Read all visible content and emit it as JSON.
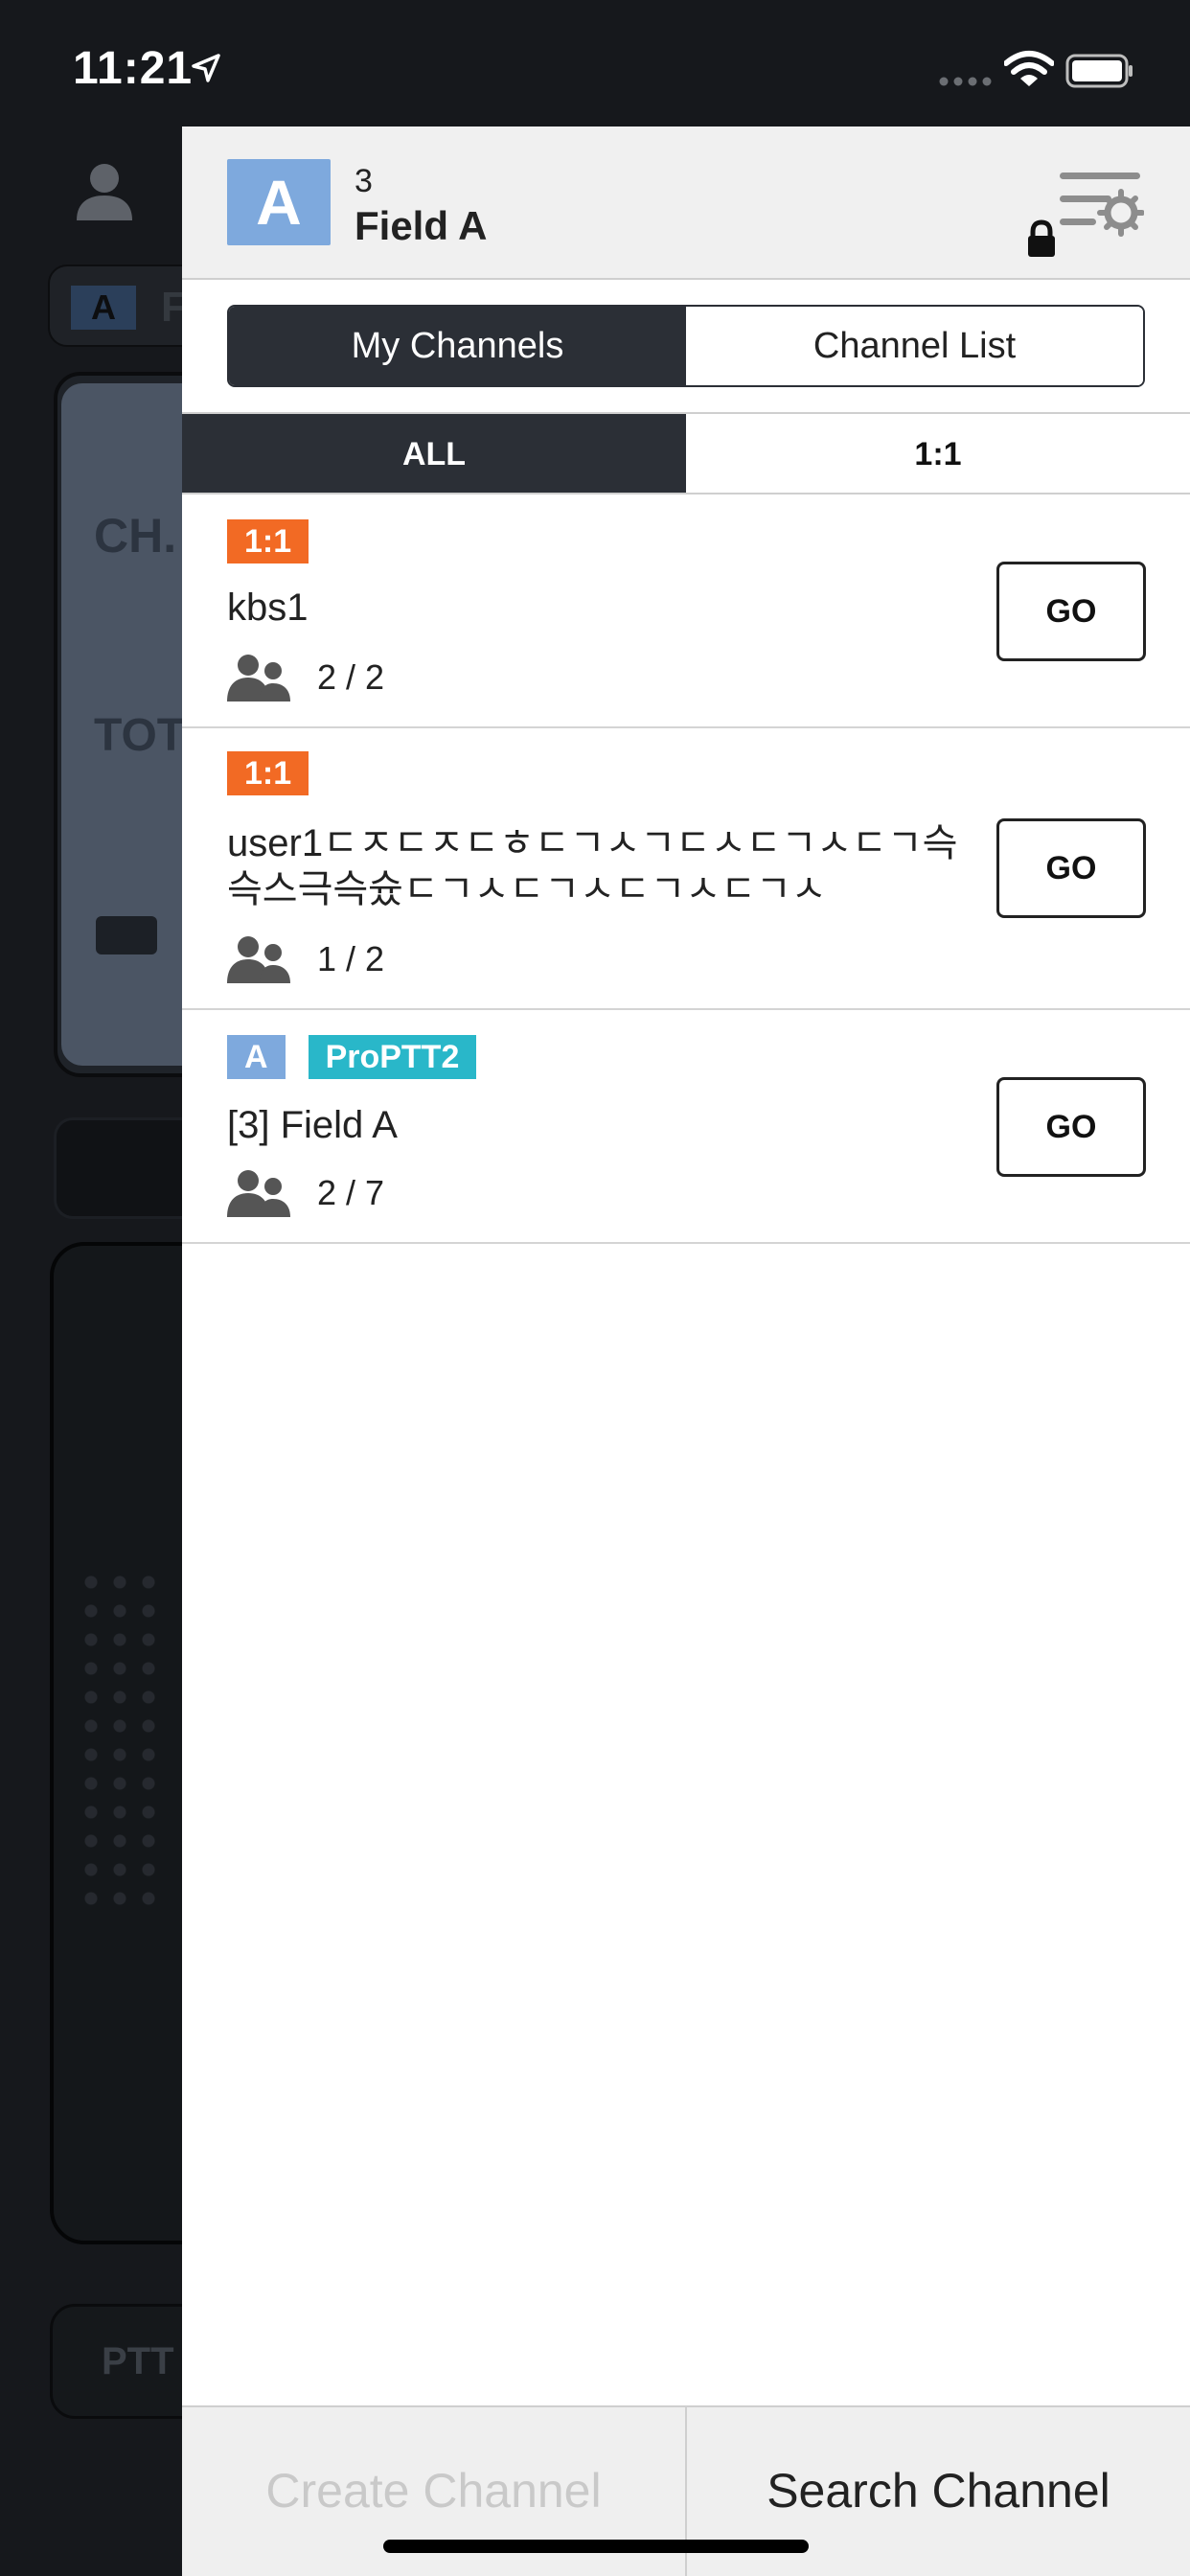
{
  "status_bar": {
    "time": "11:21"
  },
  "background": {
    "header_badge": "A",
    "header_text": "F",
    "ch_label": "CH.",
    "tot_label": "TOT",
    "ptt_label": "PTT"
  },
  "drawer": {
    "group": {
      "badge": "A",
      "number": "3",
      "name": "Field A"
    },
    "segment_tabs": [
      {
        "label": "My Channels",
        "active": true
      },
      {
        "label": "Channel List",
        "active": false
      }
    ],
    "subtabs": [
      {
        "label": "ALL",
        "active": true
      },
      {
        "label": "1:1",
        "active": false
      }
    ],
    "channels": [
      {
        "tags": [
          {
            "text": "1:1",
            "color": "#f26a24"
          }
        ],
        "name": "kbs1",
        "members": "2 / 2",
        "go": "GO"
      },
      {
        "tags": [
          {
            "text": "1:1",
            "color": "#f26a24"
          }
        ],
        "name": "user1ㄷㅈㄷㅈㄷㅎㄷㄱㅅㄱㄷㅅㄷㄱㅅㄷㄱ슥슥스극슥슜ㄷㄱㅅㄷㄱㅅㄷㄱㅅㄷㄱㅅ",
        "members": "1 / 2",
        "go": "GO"
      },
      {
        "tags": [
          {
            "text": "A",
            "color": "#7ea9dd"
          },
          {
            "text": "ProPTT2",
            "color": "#29b7c9"
          }
        ],
        "name": "[3] Field A",
        "members": "2 / 7",
        "go": "GO"
      }
    ],
    "footer": {
      "create_label": "Create Channel",
      "search_label": "Search Channel"
    }
  },
  "colors": {
    "accent_dark": "#2b2f36",
    "orange": "#f26a24",
    "blue": "#7ea9dd",
    "teal": "#29b7c9"
  },
  "icons": [
    "location-arrow-icon",
    "cellular-icon",
    "wifi-icon",
    "battery-icon",
    "user-icon",
    "settings-lock-icon",
    "members-icon"
  ]
}
